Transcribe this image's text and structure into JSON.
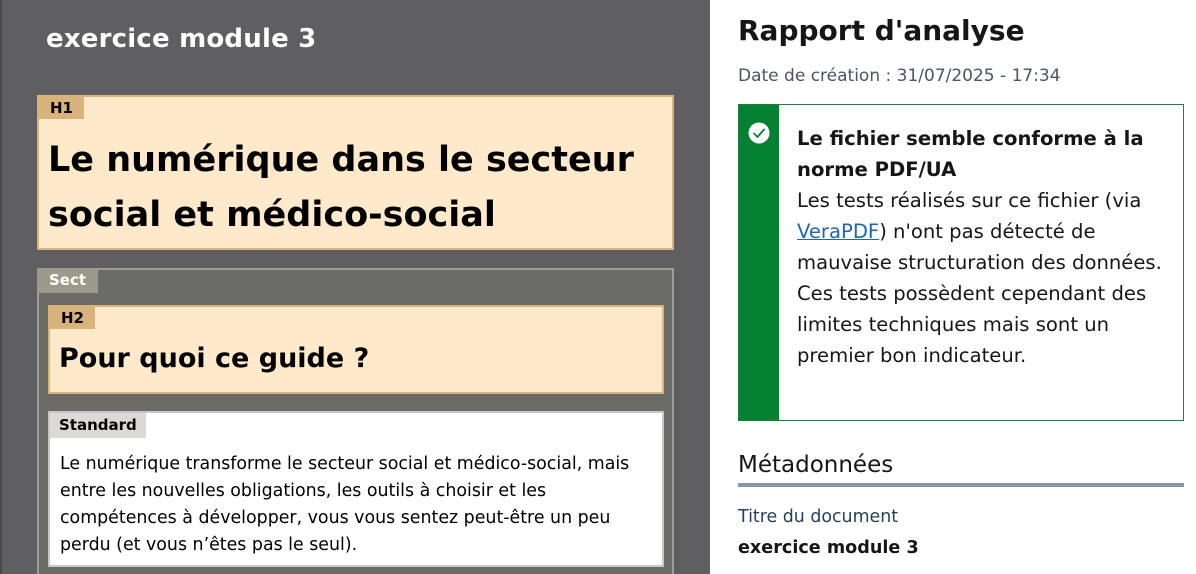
{
  "left": {
    "doc_title": "exercice module 3",
    "h1": {
      "tag": "H1",
      "text": "Le numérique dans le secteur social et médico-social"
    },
    "sect": {
      "tag": "Sect"
    },
    "h2": {
      "tag": "H2",
      "text": "Pour quoi ce guide ?"
    },
    "standard": {
      "tag": "Standard",
      "text": "Le numérique transforme le secteur social et médico-social, mais entre les nouvelles obligations, les outils à choisir et les compétences à développer, vous vous sentez peut-être un peu perdu (et vous n’êtes pas le seul)."
    }
  },
  "report": {
    "title": "Rapport d'analyse",
    "creation_label": "Date de création : ",
    "creation_value": "31/07/2025 - 17:34",
    "alert": {
      "icon": "check-circle-icon",
      "title": "Le fichier semble conforme à la norme PDF/UA",
      "text_before": "Les tests réalisés sur ce fichier (via ",
      "link": "VeraPDF",
      "text_after": ") n'ont pas détecté de mauvaise structuration des données. Ces tests possèdent cependant des limites techniques mais sont un premier bon indicateur."
    },
    "metadata": {
      "heading": "Métadonnées",
      "doc_title_label": "Titre du document",
      "doc_title_value": "exercice module 3"
    }
  },
  "colors": {
    "left_bg": "#5f5f61",
    "heading_fill": "#ffe9cb",
    "heading_tag": "#d8b37c",
    "success": "#058132",
    "link": "#1d67b1"
  }
}
